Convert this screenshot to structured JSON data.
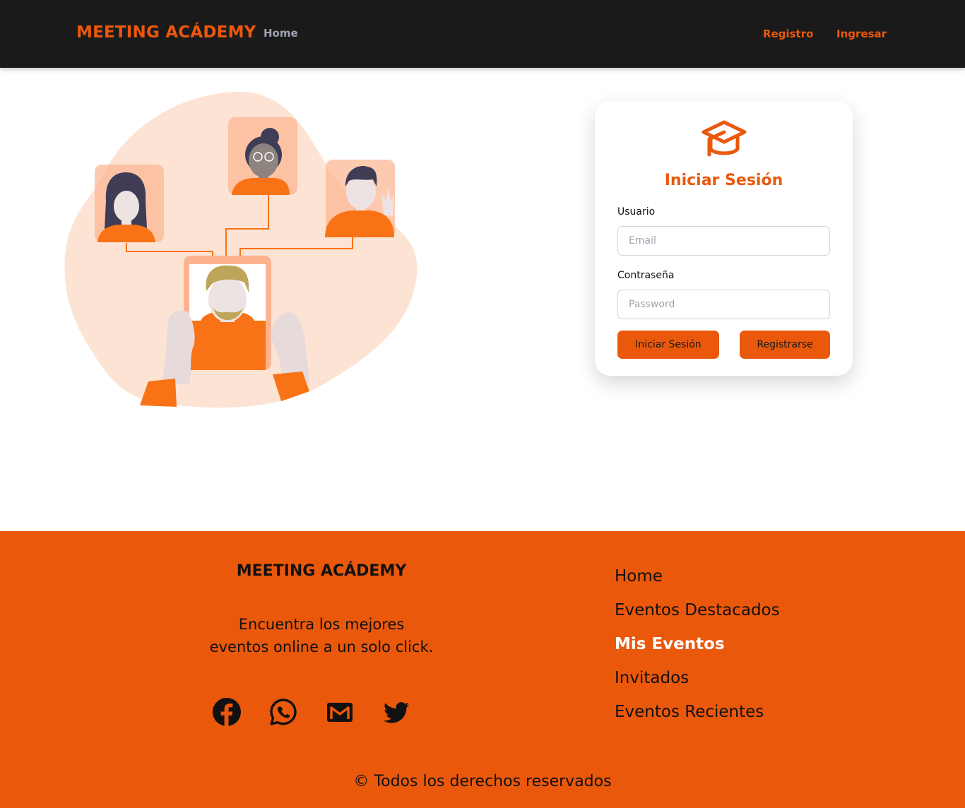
{
  "navbar": {
    "brand": "MEETING ACÁDEMY",
    "home": "Home",
    "registro": "Registro",
    "ingresar": "Ingresar"
  },
  "login": {
    "title": "Iniciar Sesión",
    "user_label": "Usuario",
    "email_placeholder": "Email",
    "email_value": "",
    "password_label": "Contraseña",
    "password_placeholder": "Password",
    "password_value": "",
    "login_button": "Iniciar Sesión",
    "register_button": "Registrarse",
    "icon": "graduation-cap-icon"
  },
  "footer": {
    "brand": "MEETING ACÁDEMY",
    "description_line1": "Encuentra los mejores",
    "description_line2": "eventos online a un solo click.",
    "social": [
      "facebook-icon",
      "whatsapp-icon",
      "gmail-icon",
      "twitter-icon"
    ],
    "links": [
      {
        "label": "Home",
        "active": false
      },
      {
        "label": "Eventos Destacados",
        "active": false
      },
      {
        "label": "Mis Eventos",
        "active": true
      },
      {
        "label": "Invitados",
        "active": false
      },
      {
        "label": "Eventos Recientes",
        "active": false
      }
    ],
    "copyright": "© Todos los derechos reservados"
  },
  "colors": {
    "accent": "#ea580c",
    "navbar_bg": "#1a1a1b",
    "footer_bg": "#ea580c",
    "active_link": "#ffffff"
  }
}
